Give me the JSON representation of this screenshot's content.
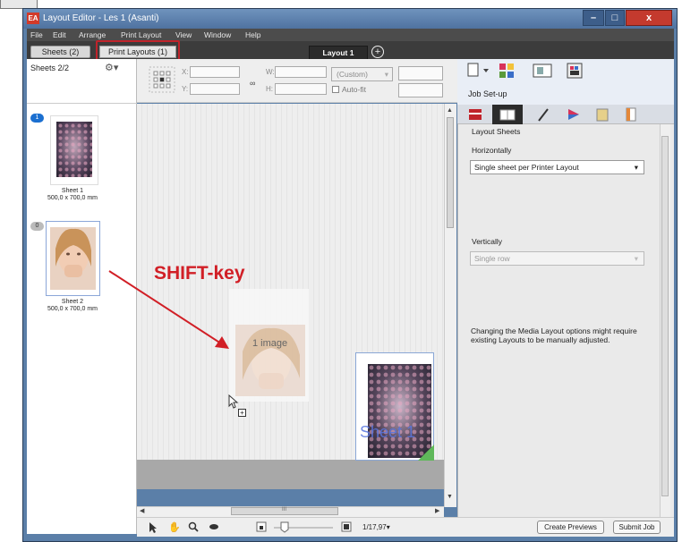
{
  "window": {
    "app_icon": "EA",
    "title": "Layout Editor - Les 1 (Asanti)",
    "controls": {
      "minimize": "–",
      "maximize": "□",
      "close": "x"
    }
  },
  "menubar": {
    "items": [
      "File",
      "Edit",
      "Arrange",
      "Print Layout",
      "View",
      "Window",
      "Help"
    ]
  },
  "tabs": {
    "sheets": "Sheets (2)",
    "print_layouts": "Print Layouts (1)",
    "layout": "Layout 1",
    "add": "+"
  },
  "sheets_panel": {
    "count": "Sheets 2/2",
    "gear": "⚙▾",
    "items": [
      {
        "badge": "1",
        "name": "Sheet 1",
        "size": "500,0 x 700,0 mm"
      },
      {
        "badge": "0",
        "name": "Sheet 2",
        "size": "500,0 x 700,0 mm"
      }
    ]
  },
  "toolbar": {
    "x_label": "X:",
    "y_label": "Y:",
    "w_label": "W:",
    "h_label": "H:",
    "preset": "(Custom)",
    "autofit": "Auto-fit"
  },
  "canvas": {
    "annotation": "SHIFT-key",
    "ghost_label": "1 image",
    "sheet_card_label": "Sheet 1",
    "hscroll_mark": "III"
  },
  "right_panel": {
    "section_title": "Job Set-up",
    "heading": "Layout Sheets",
    "horizontal_label": "Horizontally",
    "horizontal_value": "Single sheet per Printer Layout",
    "vertical_label": "Vertically",
    "vertical_value": "Single row",
    "note": "Changing the Media Layout options might require existing Layouts to be manually adjusted."
  },
  "bottom_bar": {
    "zoom": "1/17,97▾",
    "create_previews": "Create Previews",
    "submit_job": "Submit Job"
  },
  "colors": {
    "title_bar": "#5b7fa8",
    "highlight_red": "#c0232b",
    "annotation_red": "#d11f26",
    "selection_blue": "#8aa7d6",
    "badge_blue": "#1b6fd0"
  }
}
